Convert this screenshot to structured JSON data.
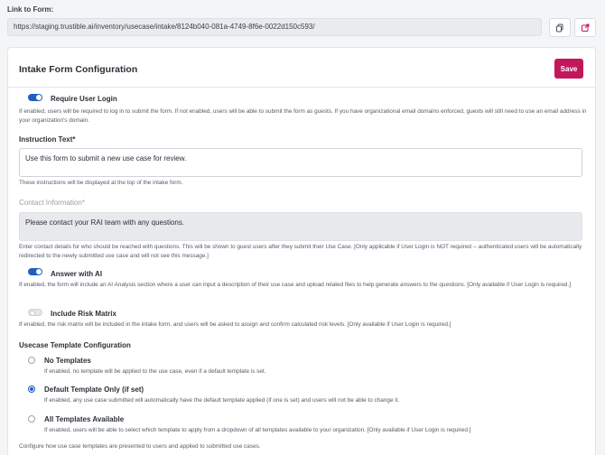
{
  "link": {
    "label": "Link to Form:",
    "url": "https://staging.trustible.ai/inventory/usecase/intake/8124b040-081a-4749-8f6e-0022d150c593/",
    "copy_icon": "copy-icon",
    "open_icon": "external-link-icon"
  },
  "card": {
    "title": "Intake Form Configuration",
    "save_label": "Save",
    "accent_color": "#c2185b"
  },
  "require_login": {
    "label": "Require User Login",
    "enabled": true,
    "help": "If enabled, users will be required to log in to submit the form. If not enabled, users will be able to submit the form as guests. If you have organizational email domains enforced, guests will still need to use an email address in your organization's domain."
  },
  "instruction": {
    "label": "Instruction Text*",
    "value": "Use this form to submit a new use case for review.",
    "help": "These instructions will be displayed at the top of the intake form."
  },
  "contact": {
    "label": "Contact Information*",
    "value": "Please contact your RAI team with any questions.",
    "help": "Enter contact details for who should be reached with questions. This will be shown to guest users after they submit their Use Case. [Only applicable if User Login is NOT required -- authenticated users will be automatically redirected to the newly submitted use case and will not see this message.]"
  },
  "answer_ai": {
    "label": "Answer with AI",
    "enabled": true,
    "help": "If enabled, the form will include an AI Analysis section where a user can input a description of their use case and upload related files to help generate answers to the questions. [Only available if User Login is required.]"
  },
  "risk_matrix": {
    "label": "Include Risk Matrix",
    "enabled": false,
    "help": "If enabled, the risk matrix will be included in the intake form, and users will be asked to assign and confirm calculated risk levels. [Only available if User Login is required.]"
  },
  "template_config": {
    "label": "Usecase Template Configuration",
    "options": [
      {
        "label": "No Templates",
        "checked": false,
        "help": "If enabled, no template will be applied to the use case, even if a default template is set."
      },
      {
        "label": "Default Template Only (if set)",
        "checked": true,
        "help": "If enabled, any use case submitted will automatically have the default template applied (if one is set) and users will not be able to change it."
      },
      {
        "label": "All Templates Available",
        "checked": false,
        "help": "If enabled, users will be able to select which template to apply from a dropdown of all templates available to your organization. [Only available if User Login is required.]"
      }
    ],
    "footer": "Configure how use case templates are presented to users and applied to submitted use cases."
  }
}
